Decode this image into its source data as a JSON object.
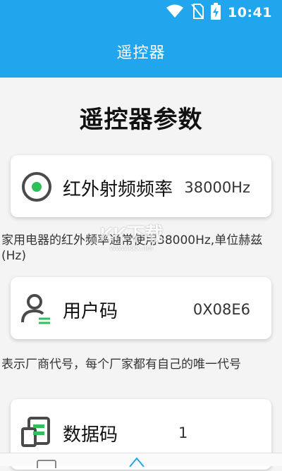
{
  "status_bar": {
    "time": "10:41",
    "icons": [
      "wifi-icon",
      "no-sim-icon",
      "battery-charging-icon"
    ]
  },
  "app_bar": {
    "title": "遥控器"
  },
  "page": {
    "heading": "遥控器参数"
  },
  "params": [
    {
      "icon": "radio-button-icon",
      "label": "红外射频频率",
      "value": "38000Hz",
      "description": "家用电器的红外频率通常使用38000Hz,单位赫兹(Hz)"
    },
    {
      "icon": "user-code-icon",
      "label": "用户码",
      "value": "0X08E6",
      "description": "表示厂商代号，每个厂家都有自己的唯一代号"
    },
    {
      "icon": "data-code-icon",
      "label": "数据码",
      "value": "1"
    }
  ],
  "bottom_nav": {
    "items": [
      "remote-tab-icon",
      "tools-tab-icon"
    ]
  },
  "watermark": {
    "text": "KK下载",
    "url": "www.kkx.net"
  },
  "colors": {
    "primary": "#21a5ec",
    "accent_green": "#2fbf5b",
    "icon_dark": "#4a4a4a"
  }
}
